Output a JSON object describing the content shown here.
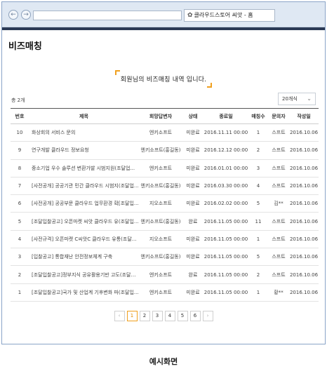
{
  "browser": {
    "back_icon": "back-arrow-icon",
    "forward_icon": "forward-arrow-icon",
    "address_value": "",
    "tab_title": "클라우드스토어 씨앗 - 홈"
  },
  "page": {
    "title": "비즈매칭",
    "headline": "회원님의 비즈매칭 내역 입니다.",
    "total_label": "총 2개",
    "page_size": "20개식",
    "accent_color": "#f0a01e"
  },
  "table": {
    "columns": [
      "번호",
      "제목",
      "회망답변자",
      "상태",
      "종료일",
      "매칭수",
      "문의자",
      "작성일"
    ],
    "rows": [
      [
        "10",
        "화상회의 서비스 문의",
        "엔키소프트",
        "미완료",
        "2016.11.11 00:00",
        "1",
        "스프트",
        "2016.10.06"
      ],
      [
        "9",
        "연구개발 클라우드 정보요청",
        "엔키소프트(홍길동)",
        "미완료",
        "2016.12.12 00:00",
        "2",
        "스프트",
        "2016.10.06"
      ],
      [
        "8",
        "중소기업 우수 솔루션 변환가발 시범지원(조달업...",
        "엔키소프트",
        "미완료",
        "2016.01.01 00:00",
        "3",
        "스프트",
        "2016.10.06"
      ],
      [
        "7",
        "[사전공개] 공공기관 민간 클라우드 시범지(조달업...",
        "엔키소프트(홍길동)",
        "미완료",
        "2016.03.30 00:00",
        "4",
        "스프트",
        "2016.10.06"
      ],
      [
        "6",
        "[사전공개] 공공부문 클라우드 업무환경 확[조달입...",
        "지오소프트",
        "미완료",
        "2016.02.02 00:00",
        "5",
        "김**",
        "2016.10.06"
      ],
      [
        "5",
        "[조달입찰공고] 오픈마켓 씨앗 클라우드 유(조달입...",
        "엔키소프트(홍길동)",
        "완료",
        "2016.11.05 00:00",
        "11",
        "스프트",
        "2016.10.06"
      ],
      [
        "4",
        "[사전규격] 오픈마켓 C씨앗C 클라우드 유통(조달...",
        "지오소프트",
        "미완료",
        "2016.11.05 00:00",
        "1",
        "스프트",
        "2016.10.06"
      ],
      [
        "3",
        "[입찰공고] 통합재난 안전정보체계 구축",
        "엔키소프트(홍길동)",
        "미완료",
        "2016.11.05 00:00",
        "5",
        "스프트",
        "2016.10.06"
      ],
      [
        "2",
        "[조달입찰공고]정부지식 공유활용기반 고도(조달입...",
        "엔키소프트",
        "완료",
        "2016.11.05 00:00",
        "2",
        "스프트",
        "2016.10.06"
      ],
      [
        "1",
        "[조달입찰공고]국가 및 산업계 기후변화 파(조달입...",
        "엔키소프트",
        "미완료",
        "2016.11.05 00:00",
        "1",
        "황**",
        "2016.10.06"
      ]
    ]
  },
  "pagination": {
    "prev": "‹",
    "next": "›",
    "pages": [
      "1",
      "2",
      "3",
      "4",
      "5",
      "6"
    ],
    "current": "1"
  },
  "caption": "예시화면"
}
